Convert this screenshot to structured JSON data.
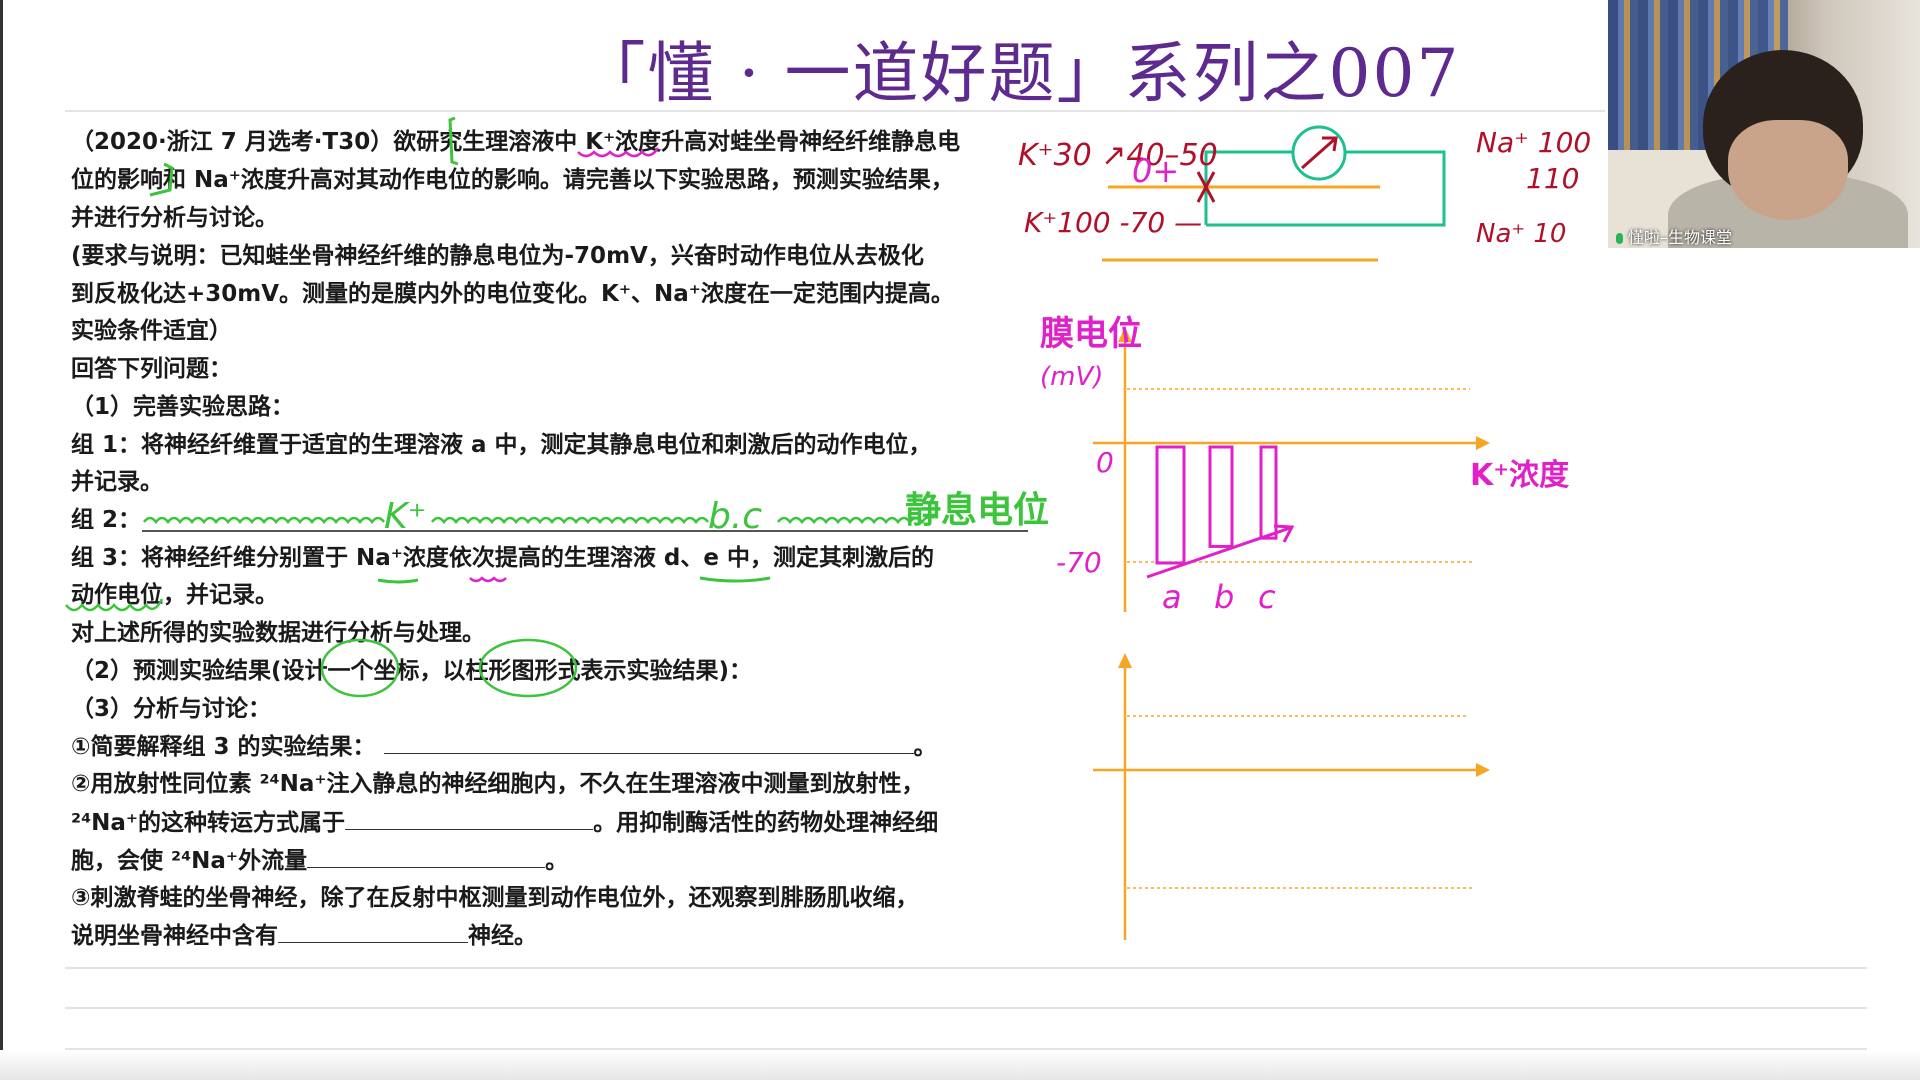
{
  "title": "「懂 · 一道好题」系列之007",
  "question": {
    "lines": [
      "（2020·浙江 7 月选考·T30）欲研究生理溶液中 K⁺浓度升高对蛙坐骨神经纤维静息电",
      "位的影响和 Na⁺浓度升高对其动作电位的影响。请完善以下实验思路，预测实验结果，",
      "并进行分析与讨论。",
      "(要求与说明：已知蛙坐骨神经纤维的静息电位为-70mV，兴奋时动作电位从去极化",
      "到反极化达+30mV。测量的是膜内外的电位变化。K⁺、Na⁺浓度在一定范围内提高。",
      "实验条件适宜）",
      "回答下列问题：",
      " （1）完善实验思路：",
      "组 1：将神经纤维置于适宜的生理溶液 a 中，测定其静息电位和刺激后的动作电位，",
      "并记录。",
      "组 2：",
      "组 3：将神经纤维分别置于 Na⁺浓度依次提高的生理溶液 d、e 中，测定其刺激后的",
      "动作电位，并记录。",
      "对上述所得的实验数据进行分析与处理。",
      " （2）预测实验结果(设计一个坐标，以柱形图形式表示实验结果)：",
      " （3）分析与讨论：",
      "①简要解释组 3 的实验结果：",
      "②用放射性同位素 ²⁴Na⁺注入静息的神经细胞内，不久在生理溶液中测量到放射性，",
      "²⁴Na⁺的这种转运方式属于",
      "胞，会使 ²⁴Na⁺外流量",
      "③刺激脊蛙的坐骨神经，除了在反射中枢测量到动作电位外，还观察到腓肠肌收缩，",
      "说明坐骨神经中含有"
    ],
    "tails": {
      "q1_end": "。",
      "q2_mid": "。用抑制酶活性的药物处理神经细",
      "q2_end": "。",
      "q3_end": "神经。"
    }
  },
  "annotations": {
    "group2_k": "K⁺",
    "group2_bc": "b.c",
    "group2_resting": "静息电位",
    "k30": "K⁺30 ↗40–50",
    "zero_plus": "0+",
    "k100": "K⁺100 -70 —",
    "na100": "Na⁺ 100",
    "n110": "110",
    "na10": "Na⁺ 10",
    "y_label": "膜电位",
    "y_unit": "(mV)",
    "tick_0": "0",
    "tick_neg70": "-70",
    "x_label": "K⁺浓度",
    "bar_labels": [
      "a",
      "b",
      "c"
    ]
  },
  "sketch_bars": {
    "values_mV": [
      -70,
      -60,
      -55
    ],
    "ylim": [
      -70,
      30
    ]
  },
  "webcam": {
    "label": "懂啦–生物课堂",
    "icon": "microphone-icon"
  },
  "colors": {
    "title": "#5e2a8f",
    "green_ink": "#3cc43c",
    "magenta_ink": "#e020c8",
    "red_ink": "#b0102a",
    "axis": "#f5a623",
    "circuit": "#1fbf8f"
  }
}
